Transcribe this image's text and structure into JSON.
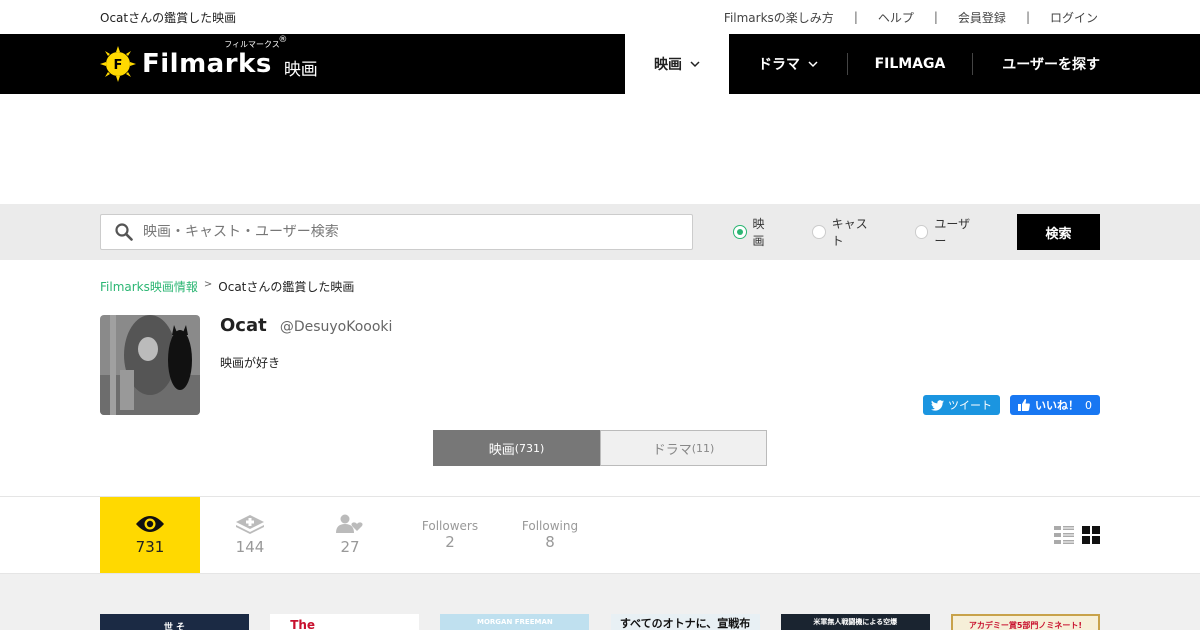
{
  "topbar": {
    "page_label": "Ocatさんの鑑賞した映画",
    "links": [
      "Filmarksの楽しみ方",
      "ヘルプ",
      "会員登録",
      "ログイン"
    ]
  },
  "header": {
    "brand": "Filmarks",
    "brand_kana": "フィルマークス",
    "brand_reg": "®",
    "sub": "映画",
    "nav": {
      "movies": "映画",
      "drama": "ドラマ",
      "filmaga": "FILMAGA",
      "users": "ユーザーを探す"
    }
  },
  "search": {
    "placeholder": "映画・キャスト・ユーザー検索",
    "options": [
      "映画",
      "キャスト",
      "ユーザー"
    ],
    "selected": "映画",
    "button": "検索"
  },
  "breadcrumb": {
    "root": "Filmarks映画情報",
    "sep": ">",
    "current": "Ocatさんの鑑賞した映画"
  },
  "profile": {
    "name": "Ocat",
    "handle": "@DesuyoKoooki",
    "bio": "映画が好き",
    "tweet": "ツイート",
    "like": "いいね！",
    "like_count": "0"
  },
  "tabs": [
    {
      "label": "映画",
      "count": "(731)"
    },
    {
      "label": "ドラマ",
      "count": "(11)"
    }
  ],
  "stats": {
    "watched": "731",
    "clips": "144",
    "fans": "27",
    "followers_label": "Followers",
    "followers": "2",
    "following_label": "Following",
    "following": "8"
  },
  "posters": [
    "世 そ",
    "The",
    "MORGAN FREEMAN",
    "すべてのオトナに、宣戦布告。",
    "米軍無人戦闘機による空爆",
    "アカデミー賞5部門ノミネート!"
  ],
  "colors": {
    "accent_green": "#2bb673",
    "active_yellow": "#ffd900",
    "header_black": "#000000"
  }
}
